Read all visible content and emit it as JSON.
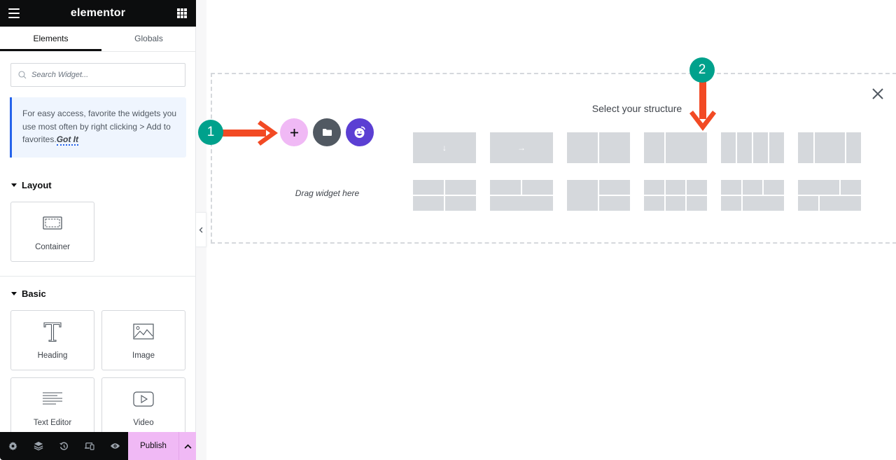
{
  "topbar": {
    "logo": "elementor",
    "menu_icon": "hamburger-icon",
    "apps_icon": "grid-icon"
  },
  "tabs": [
    {
      "label": "Elements",
      "active": true
    },
    {
      "label": "Globals",
      "active": false
    }
  ],
  "search": {
    "placeholder": "Search Widget...",
    "value": ""
  },
  "notice": {
    "text": "For easy access, favorite the widgets you use most often by right clicking > Add to favorites.",
    "link": "Got It"
  },
  "sections": {
    "layout": {
      "title": "Layout",
      "widgets": [
        {
          "label": "Container",
          "icon": "container-icon"
        }
      ]
    },
    "basic": {
      "title": "Basic",
      "widgets": [
        {
          "label": "Heading",
          "icon": "heading-icon"
        },
        {
          "label": "Image",
          "icon": "image-icon"
        },
        {
          "label": "Text Editor",
          "icon": "text-editor-icon"
        },
        {
          "label": "Video",
          "icon": "video-icon"
        }
      ]
    }
  },
  "bottombar": {
    "icons": [
      "settings-icon",
      "layers-icon",
      "history-icon",
      "responsive-icon",
      "preview-icon"
    ],
    "publish_label": "Publish",
    "more_icon": "chevron-up-icon"
  },
  "canvas": {
    "structure_title": "Select your structure",
    "drag_label": "Drag widget here",
    "add_buttons": [
      "add-section-icon",
      "template-library-icon",
      "ai-icon"
    ],
    "structure_presets": [
      {
        "name": "flexbox-column",
        "glyph": "↓"
      },
      {
        "name": "flexbox-row",
        "glyph": "→"
      },
      {
        "name": "two-columns-equal",
        "glyph": ""
      },
      {
        "name": "two-columns-33-66",
        "glyph": ""
      },
      {
        "name": "four-columns",
        "glyph": ""
      },
      {
        "name": "three-columns-25-50-25",
        "glyph": ""
      },
      {
        "name": "grid-2x2",
        "glyph": ""
      },
      {
        "name": "two-over-one",
        "glyph": ""
      },
      {
        "name": "one-left-two-right",
        "glyph": ""
      },
      {
        "name": "grid-3x2",
        "glyph": ""
      },
      {
        "name": "three-over-two",
        "glyph": ""
      },
      {
        "name": "two-over-two-offset",
        "glyph": ""
      }
    ]
  },
  "annotations": [
    {
      "number": "1",
      "color": "#00a18c"
    },
    {
      "number": "2",
      "color": "#00a18c"
    }
  ],
  "colors": {
    "accent_pink": "#f0b9f5",
    "annotation_arrow": "#f24a24",
    "notice_border": "#2563eb",
    "ai_purple": "#5b3fd3"
  }
}
